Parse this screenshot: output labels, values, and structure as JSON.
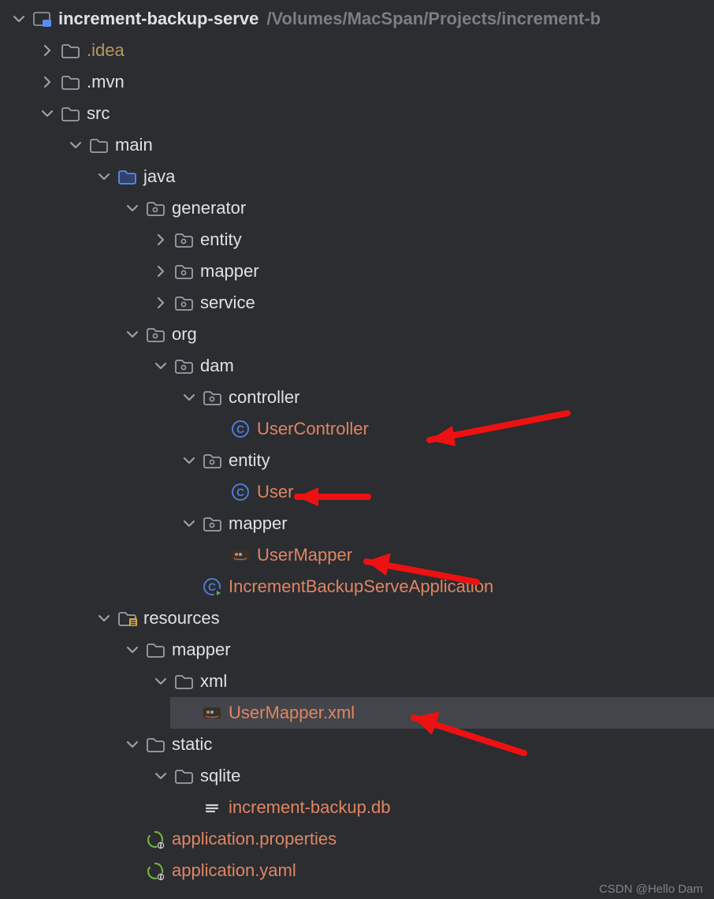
{
  "root": {
    "name": "increment-backup-serve",
    "path": "/Volumes/MacSpan/Projects/increment-b"
  },
  "nodes": {
    "idea": ".idea",
    "mvn": ".mvn",
    "src": "src",
    "main": "main",
    "java": "java",
    "generator": "generator",
    "entity": "entity",
    "mapper": "mapper",
    "service": "service",
    "org": "org",
    "dam": "dam",
    "controller": "controller",
    "userController": "UserController",
    "entity2": "entity",
    "user": "User",
    "mapper2": "mapper",
    "userMapper": "UserMapper",
    "app": "IncrementBackupServeApplication",
    "resources": "resources",
    "mapperRes": "mapper",
    "xml": "xml",
    "userMapperXml": "UserMapper.xml",
    "static": "static",
    "sqlite": "sqlite",
    "db": "increment-backup.db",
    "appProps": "application.properties",
    "appYaml": "application.yaml"
  },
  "watermark": "CSDN @Hello Dam"
}
